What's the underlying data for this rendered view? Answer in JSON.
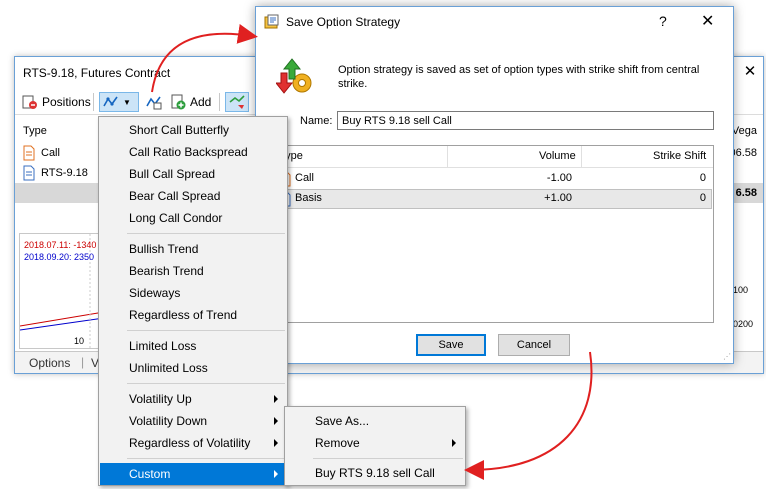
{
  "main_window": {
    "title": "RTS-9.18, Futures Contract",
    "close_glyph": "✕",
    "toolbar": {
      "positions_label": "Positions",
      "add_label": "Add"
    },
    "grid": {
      "type_header": "Type",
      "vega_header": "Vega",
      "rows": [
        {
          "type": "Call",
          "vega": "06.58"
        },
        {
          "type": "RTS-9.18",
          "vega": ""
        }
      ],
      "summary_vega": "6.58"
    },
    "chart": {
      "legend_1": "2018.07.11: -1340",
      "legend_2": "2018.09.20: 2350",
      "tick_label": "10",
      "right_tick_1": "100",
      "right_tick_2": "0200",
      "color_1": "#cc0000",
      "color_2": "#0000cc"
    },
    "tabs": {
      "options_label": "Options",
      "second_label": "V"
    }
  },
  "strategy_menu": {
    "items": [
      {
        "label": "Short Call Butterfly",
        "submenu": false
      },
      {
        "label": "Call Ratio Backspread",
        "submenu": false
      },
      {
        "label": "Bull Call Spread",
        "submenu": false
      },
      {
        "label": "Bear Call Spread",
        "submenu": false
      },
      {
        "label": "Long Call Condor",
        "submenu": false
      },
      {
        "label": "Bullish Trend",
        "submenu": false
      },
      {
        "label": "Bearish Trend",
        "submenu": false
      },
      {
        "label": "Sideways",
        "submenu": false
      },
      {
        "label": "Regardless of Trend",
        "submenu": false
      },
      {
        "label": "Limited Loss",
        "submenu": false
      },
      {
        "label": "Unlimited Loss",
        "submenu": false
      },
      {
        "label": "Volatility Up",
        "submenu": true
      },
      {
        "label": "Volatility Down",
        "submenu": true
      },
      {
        "label": "Regardless of Volatility",
        "submenu": true
      },
      {
        "label": "Custom",
        "submenu": true,
        "active": true
      }
    ]
  },
  "custom_submenu": {
    "items": [
      {
        "label": "Save As...",
        "submenu": false
      },
      {
        "label": "Remove",
        "submenu": true
      },
      {
        "label": "Buy RTS 9.18 sell Call",
        "submenu": false
      }
    ]
  },
  "dialog": {
    "title": "Save Option Strategy",
    "help_glyph": "?",
    "close_glyph": "✕",
    "description": "Option strategy is saved as set of option types with strike shift from central strike.",
    "name_label": "Name:",
    "name_value": "Buy RTS 9.18 sell Call",
    "table": {
      "headers": {
        "type": "Type",
        "volume": "Volume",
        "strike_shift": "Strike Shift"
      },
      "rows": [
        {
          "type": "Call",
          "volume": "-1.00",
          "strike_shift": "0"
        },
        {
          "type": "Basis",
          "volume": "+1.00",
          "strike_shift": "0"
        }
      ]
    },
    "save_label": "Save",
    "cancel_label": "Cancel"
  },
  "colors": {
    "accent": "#0078d7",
    "annotation_arrow": "#e02020",
    "window_border": "#6aa0d6"
  }
}
